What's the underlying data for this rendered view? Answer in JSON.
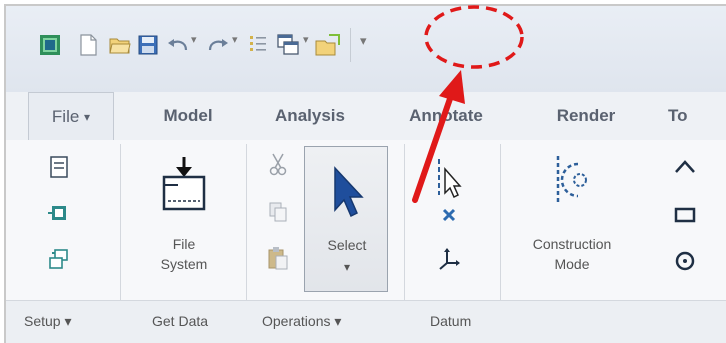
{
  "quick_access": {
    "icons": [
      "app-logo-icon",
      "new-file-icon",
      "open-file-icon",
      "save-icon",
      "undo-icon",
      "redo-icon",
      "regenerate-icon",
      "windows-icon",
      "close-window-icon",
      "customize-toolbar-icon"
    ]
  },
  "tabs": [
    "File",
    "Model",
    "Analysis",
    "Annotate",
    "Render",
    "To"
  ],
  "file_tab": {
    "label": "File",
    "arrow": "▾"
  },
  "ribbon": {
    "file_system": {
      "line1": "File",
      "line2": "System"
    },
    "select": {
      "label": "Select",
      "arrow": "▾"
    },
    "construction_mode": {
      "line1": "Construction",
      "line2": "Mode"
    }
  },
  "groups": {
    "setup": "Setup ▾",
    "get_data": "Get Data",
    "operations": "Operations ▾",
    "datum": "Datum"
  },
  "colors": {
    "annotation_red": "#e01919",
    "accent_blue": "#1f4e9c",
    "icon_teal": "#2d8a8a"
  }
}
